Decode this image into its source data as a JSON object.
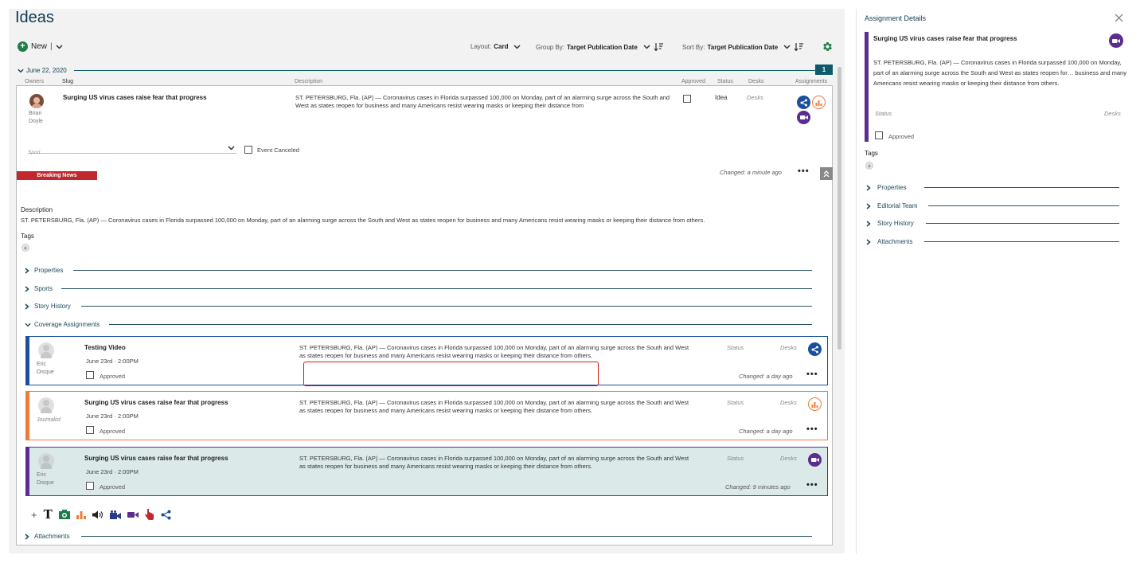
{
  "page": {
    "title": "Ideas"
  },
  "toolbar": {
    "new_label": "New",
    "separator": "|",
    "layout_label": "Layout:",
    "layout_value": "Card",
    "groupby_label": "Group By:",
    "groupby_value": "Target Publication Date",
    "sortby_label": "Sort By:",
    "sortby_value": "Target Publication Date"
  },
  "group": {
    "date": "June 22, 2020",
    "count": "1"
  },
  "columns": {
    "owners": "Owners",
    "slug": "Slug",
    "description": "Description",
    "approved": "Approved",
    "status": "Status",
    "desks": "Desks",
    "assignments": "Assignments"
  },
  "story": {
    "owner_first": "Brian",
    "owner_last": "Doyle",
    "slug": "Surging US virus cases raise fear that progress",
    "description_short": "ST. PETERSBURG, Fla. (AP) — Coronavirus cases in Florida surpassed 100,000 on Monday, part of an alarming surge across the South and West as states reopen for business and many Americans resist wearing masks or keeping their distance from",
    "status": "Idea",
    "desks": "Desks",
    "sport_placeholder": "Sport",
    "event_canceled": "Event Canceled",
    "badge": "Breaking News",
    "changed": "Changed: a minute ago",
    "description_heading": "Description",
    "description_full": "ST. PETERSBURG, Fla. (AP) — Coronavirus cases in Florida surpassed 100,000 on Monday, part of an alarming surge across the South and West as states reopen for business and many Americans resist wearing masks or keeping their distance from others.",
    "tags_heading": "Tags"
  },
  "sections": [
    "Properties",
    "Sports",
    "Story History",
    "Coverage Assignments",
    "Attachments"
  ],
  "assignments": [
    {
      "person_first": "Eric",
      "person_last": "Disque",
      "title": "Testing Video",
      "date": "June 23rd · 2:00PM",
      "desc_line1": "ST. PETERSBURG, Fla. (AP) — Coronavirus cases in Florida surpassed 100,000 on Monday, part of an alarming surge across the South and West",
      "desc_line2": "as states reopen for business and many Americans resist wearing masks or keeping their distance from others.",
      "status": "Status",
      "desks": "Desks",
      "approved": "Approved",
      "changed": "Changed: a day ago",
      "accent": "#1b4f9c"
    },
    {
      "person_first": "Journalist",
      "person_last": "",
      "title": "Surging US virus cases raise fear that progress",
      "date": "June 23rd · 2:00PM",
      "desc_line1": "ST. PETERSBURG, Fla. (AP) — Coronavirus cases in Florida surpassed 100,000 on Monday, part of an alarming surge across the South and West",
      "desc_line2": "as states reopen for business and many Americans resist wearing masks or keeping their distance from others.",
      "status": "Status",
      "desks": "Desks",
      "approved": "Approved",
      "changed": "Changed: a day ago",
      "accent": "#f07a3a"
    },
    {
      "person_first": "Eric",
      "person_last": "Disque",
      "title": "Surging US virus cases raise fear that progress",
      "date": "June 23rd · 2:00PM",
      "desc_line1": "ST. PETERSBURG, Fla. (AP) — Coronavirus cases in Florida surpassed 100,000 on Monday, part of an alarming surge across the South and West",
      "desc_line2": "as states reopen for business and many Americans resist wearing masks or keeping their distance from others.",
      "status": "Status",
      "desks": "Desks",
      "approved": "Approved",
      "changed": "Changed: 9 minutes ago",
      "accent": "#5b2d8e"
    }
  ],
  "details": {
    "heading": "Assignment Details",
    "title": "Surging US virus cases raise fear that progress",
    "description": "ST. PETERSBURG, Fla. (AP) — Coronavirus cases in Florida surpassed 100,000 on Monday, part of an alarming surge across the South and West as states reopen for… business and many Americans resist wearing masks or keeping their distance from others.",
    "status": "Status",
    "desks": "Desks",
    "approved": "Approved",
    "tags": "Tags",
    "sections": [
      "Properties",
      "Editorial Team",
      "Story History",
      "Attachments"
    ]
  },
  "colors": {
    "primary": "#0d3b4f",
    "accent_green": "#1e7d4a",
    "badge_red": "#c0282d",
    "share_blue": "#1b4f9c",
    "chart_orange": "#f07a3a",
    "video_purple": "#5b2d8e"
  },
  "icons": [
    "plus-circle-icon",
    "chevron-down-icon",
    "sort-icon",
    "gear-icon",
    "share-icon",
    "bar-chart-icon",
    "video-icon",
    "text-icon",
    "photo-icon",
    "audio-icon",
    "camera-icon",
    "interactive-icon",
    "close-icon"
  ]
}
